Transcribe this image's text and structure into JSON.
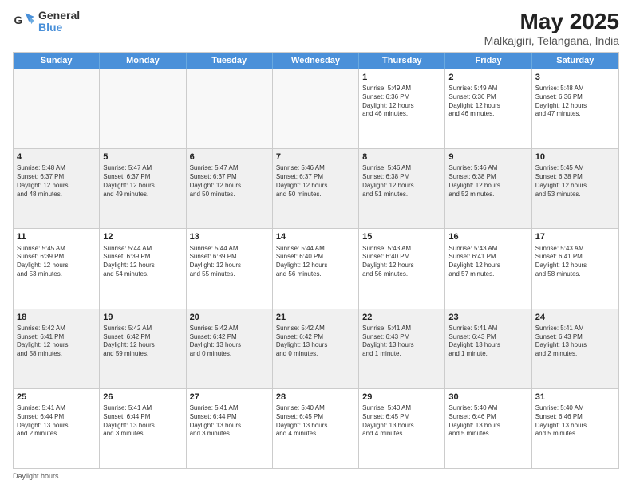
{
  "logo": {
    "line1": "General",
    "line2": "Blue"
  },
  "title": "May 2025",
  "subtitle": "Malkajgiri, Telangana, India",
  "header_days": [
    "Sunday",
    "Monday",
    "Tuesday",
    "Wednesday",
    "Thursday",
    "Friday",
    "Saturday"
  ],
  "footer": "Daylight hours",
  "rows": [
    [
      {
        "day": "",
        "info": "",
        "shaded": true
      },
      {
        "day": "",
        "info": "",
        "shaded": true
      },
      {
        "day": "",
        "info": "",
        "shaded": true
      },
      {
        "day": "",
        "info": "",
        "shaded": true
      },
      {
        "day": "1",
        "info": "Sunrise: 5:49 AM\nSunset: 6:36 PM\nDaylight: 12 hours\nand 46 minutes.",
        "shaded": false
      },
      {
        "day": "2",
        "info": "Sunrise: 5:49 AM\nSunset: 6:36 PM\nDaylight: 12 hours\nand 46 minutes.",
        "shaded": false
      },
      {
        "day": "3",
        "info": "Sunrise: 5:48 AM\nSunset: 6:36 PM\nDaylight: 12 hours\nand 47 minutes.",
        "shaded": false
      }
    ],
    [
      {
        "day": "4",
        "info": "Sunrise: 5:48 AM\nSunset: 6:37 PM\nDaylight: 12 hours\nand 48 minutes.",
        "shaded": true
      },
      {
        "day": "5",
        "info": "Sunrise: 5:47 AM\nSunset: 6:37 PM\nDaylight: 12 hours\nand 49 minutes.",
        "shaded": true
      },
      {
        "day": "6",
        "info": "Sunrise: 5:47 AM\nSunset: 6:37 PM\nDaylight: 12 hours\nand 50 minutes.",
        "shaded": true
      },
      {
        "day": "7",
        "info": "Sunrise: 5:46 AM\nSunset: 6:37 PM\nDaylight: 12 hours\nand 50 minutes.",
        "shaded": true
      },
      {
        "day": "8",
        "info": "Sunrise: 5:46 AM\nSunset: 6:38 PM\nDaylight: 12 hours\nand 51 minutes.",
        "shaded": true
      },
      {
        "day": "9",
        "info": "Sunrise: 5:46 AM\nSunset: 6:38 PM\nDaylight: 12 hours\nand 52 minutes.",
        "shaded": true
      },
      {
        "day": "10",
        "info": "Sunrise: 5:45 AM\nSunset: 6:38 PM\nDaylight: 12 hours\nand 53 minutes.",
        "shaded": true
      }
    ],
    [
      {
        "day": "11",
        "info": "Sunrise: 5:45 AM\nSunset: 6:39 PM\nDaylight: 12 hours\nand 53 minutes.",
        "shaded": false
      },
      {
        "day": "12",
        "info": "Sunrise: 5:44 AM\nSunset: 6:39 PM\nDaylight: 12 hours\nand 54 minutes.",
        "shaded": false
      },
      {
        "day": "13",
        "info": "Sunrise: 5:44 AM\nSunset: 6:39 PM\nDaylight: 12 hours\nand 55 minutes.",
        "shaded": false
      },
      {
        "day": "14",
        "info": "Sunrise: 5:44 AM\nSunset: 6:40 PM\nDaylight: 12 hours\nand 56 minutes.",
        "shaded": false
      },
      {
        "day": "15",
        "info": "Sunrise: 5:43 AM\nSunset: 6:40 PM\nDaylight: 12 hours\nand 56 minutes.",
        "shaded": false
      },
      {
        "day": "16",
        "info": "Sunrise: 5:43 AM\nSunset: 6:41 PM\nDaylight: 12 hours\nand 57 minutes.",
        "shaded": false
      },
      {
        "day": "17",
        "info": "Sunrise: 5:43 AM\nSunset: 6:41 PM\nDaylight: 12 hours\nand 58 minutes.",
        "shaded": false
      }
    ],
    [
      {
        "day": "18",
        "info": "Sunrise: 5:42 AM\nSunset: 6:41 PM\nDaylight: 12 hours\nand 58 minutes.",
        "shaded": true
      },
      {
        "day": "19",
        "info": "Sunrise: 5:42 AM\nSunset: 6:42 PM\nDaylight: 12 hours\nand 59 minutes.",
        "shaded": true
      },
      {
        "day": "20",
        "info": "Sunrise: 5:42 AM\nSunset: 6:42 PM\nDaylight: 13 hours\nand 0 minutes.",
        "shaded": true
      },
      {
        "day": "21",
        "info": "Sunrise: 5:42 AM\nSunset: 6:42 PM\nDaylight: 13 hours\nand 0 minutes.",
        "shaded": true
      },
      {
        "day": "22",
        "info": "Sunrise: 5:41 AM\nSunset: 6:43 PM\nDaylight: 13 hours\nand 1 minute.",
        "shaded": true
      },
      {
        "day": "23",
        "info": "Sunrise: 5:41 AM\nSunset: 6:43 PM\nDaylight: 13 hours\nand 1 minute.",
        "shaded": true
      },
      {
        "day": "24",
        "info": "Sunrise: 5:41 AM\nSunset: 6:43 PM\nDaylight: 13 hours\nand 2 minutes.",
        "shaded": true
      }
    ],
    [
      {
        "day": "25",
        "info": "Sunrise: 5:41 AM\nSunset: 6:44 PM\nDaylight: 13 hours\nand 2 minutes.",
        "shaded": false
      },
      {
        "day": "26",
        "info": "Sunrise: 5:41 AM\nSunset: 6:44 PM\nDaylight: 13 hours\nand 3 minutes.",
        "shaded": false
      },
      {
        "day": "27",
        "info": "Sunrise: 5:41 AM\nSunset: 6:44 PM\nDaylight: 13 hours\nand 3 minutes.",
        "shaded": false
      },
      {
        "day": "28",
        "info": "Sunrise: 5:40 AM\nSunset: 6:45 PM\nDaylight: 13 hours\nand 4 minutes.",
        "shaded": false
      },
      {
        "day": "29",
        "info": "Sunrise: 5:40 AM\nSunset: 6:45 PM\nDaylight: 13 hours\nand 4 minutes.",
        "shaded": false
      },
      {
        "day": "30",
        "info": "Sunrise: 5:40 AM\nSunset: 6:46 PM\nDaylight: 13 hours\nand 5 minutes.",
        "shaded": false
      },
      {
        "day": "31",
        "info": "Sunrise: 5:40 AM\nSunset: 6:46 PM\nDaylight: 13 hours\nand 5 minutes.",
        "shaded": false
      }
    ]
  ]
}
